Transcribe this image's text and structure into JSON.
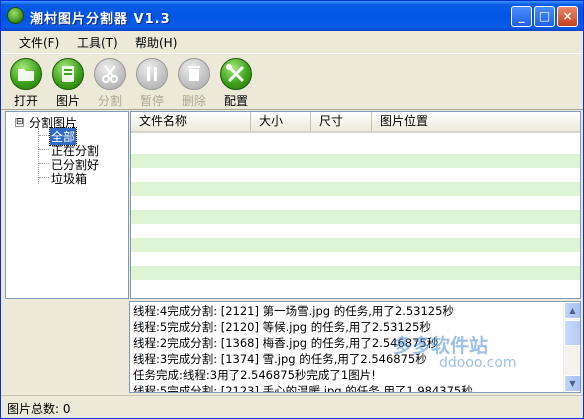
{
  "window": {
    "title": "潮村图片分割器 V1.3"
  },
  "titlebar_buttons": {
    "minimize": "_",
    "maximize": "□",
    "close": "×"
  },
  "menu": {
    "items": [
      {
        "label": "文件(F)"
      },
      {
        "label": "工具(T)"
      },
      {
        "label": "帮助(H)"
      }
    ]
  },
  "toolbar": {
    "items": [
      {
        "label": "打开",
        "icon": "folder-open-icon",
        "enabled": true
      },
      {
        "label": "图片",
        "icon": "image-icon",
        "enabled": true
      },
      {
        "label": "分割",
        "icon": "scissors-icon",
        "enabled": false
      },
      {
        "label": "暂停",
        "icon": "pause-icon",
        "enabled": false
      },
      {
        "label": "删除",
        "icon": "trash-icon",
        "enabled": false
      },
      {
        "label": "配置",
        "icon": "tools-icon",
        "enabled": true
      }
    ]
  },
  "tree": {
    "root": {
      "label": "分割图片",
      "toggle": "⊟"
    },
    "children": [
      {
        "label": "全部",
        "selected": true
      },
      {
        "label": "正在分割",
        "selected": false
      },
      {
        "label": "已分割好",
        "selected": false
      },
      {
        "label": "垃圾箱",
        "selected": false
      }
    ]
  },
  "list": {
    "columns": [
      "文件名称",
      "大小",
      "尺寸",
      "图片位置"
    ],
    "rows": []
  },
  "log": {
    "lines": [
      "线程:4完成分割: [2121] 第一场雪.jpg 的任务,用了2.53125秒",
      "线程:5完成分割: [2120] 等候.jpg 的任务,用了2.53125秒",
      "线程:2完成分割: [1368] 梅香.jpg 的任务,用了2.546875秒",
      "线程:3完成分割: [1374] 雪.jpg 的任务,用了2.546875秒",
      "任务完成:线程:3用了2.546875秒完成了1图片!",
      "线程:5完成分割: [2123] 手心的温暖.jpg 的任务,用了1.984375秒"
    ]
  },
  "watermark": {
    "text": "多多软件站",
    "sub": "ddooo.com"
  },
  "status": {
    "text": "图片总数: 0"
  },
  "colors": {
    "title_bar": "#0054e3",
    "stripe": "#ddf5d5",
    "selected": "#316ac5",
    "tool_enabled": "#3fa21c"
  }
}
